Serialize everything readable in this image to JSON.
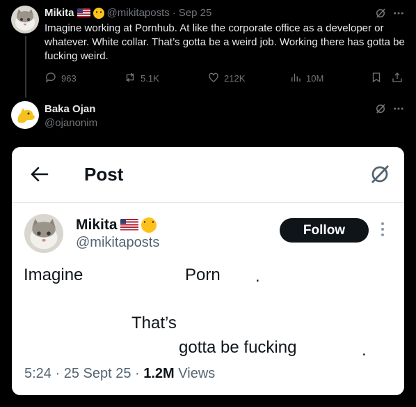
{
  "reply_thread": {
    "top_tweet": {
      "name": "Mikita",
      "handle": "@mikitaposts",
      "date": "Sep 25",
      "text": "Imagine working at Pornhub. At like the corporate office as a developer or whatever. White collar. That’s gotta be a weird job. Working there has gotta be fucking weird.",
      "stats": {
        "replies": "963",
        "reposts": "5.1K",
        "likes": "212K",
        "views": "10M"
      }
    },
    "reply_tweet": {
      "name": "Baka Ojan",
      "handle": "@ojanonim"
    }
  },
  "embedded_screenshot": {
    "header_title": "Post",
    "author_name": "Mikita",
    "author_handle": "@mikitaposts",
    "follow_label": "Follow",
    "visible_fragments": {
      "imagine": "Imagine",
      "porn": "Porn",
      "dot1": ".",
      "thats": "That’s",
      "gotta": "gotta be fucking",
      "dot2": "."
    },
    "meta": {
      "time": "5:24",
      "sep1": " · ",
      "date": "25 Sept 25",
      "sep2": " · ",
      "views_count": "1.2M",
      "views_label": " Views"
    }
  },
  "icons": [
    "grok-icon",
    "more-icon",
    "reply-icon",
    "repost-icon",
    "like-icon",
    "views-icon",
    "bookmark-icon",
    "share-icon",
    "back-arrow-icon"
  ],
  "colors": {
    "background": "#000000",
    "text": "#e7e9ea",
    "muted": "#71767b",
    "card_bg": "#ffffff",
    "follow_bg": "#0f1419"
  }
}
